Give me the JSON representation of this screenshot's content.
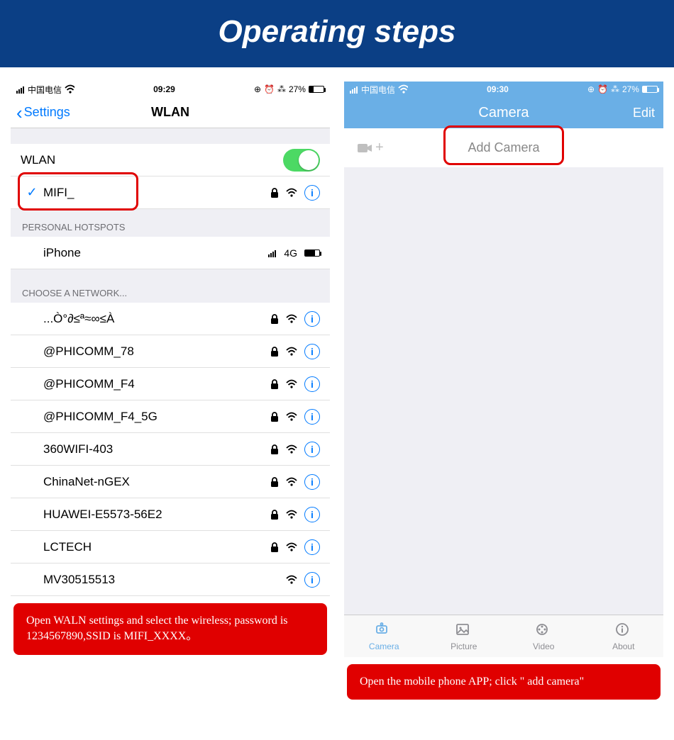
{
  "page_title": "Operating steps",
  "left": {
    "statusbar": {
      "carrier": "中国电信",
      "time": "09:29",
      "battery_pct": "27%"
    },
    "nav": {
      "back": "Settings",
      "title": "WLAN"
    },
    "wlan_toggle_label": "WLAN",
    "connected": {
      "ssid": "MIFI_"
    },
    "section_hotspots": "PERSONAL HOTSPOTS",
    "hotspot": {
      "name": "iPhone",
      "signal": "4G"
    },
    "section_choose": "CHOOSE A NETWORK...",
    "networks": [
      {
        "ssid": "...Ò°∂≤ª≈∞≤À",
        "locked": true
      },
      {
        "ssid": "@PHICOMM_78",
        "locked": true
      },
      {
        "ssid": "@PHICOMM_F4",
        "locked": true
      },
      {
        "ssid": "@PHICOMM_F4_5G",
        "locked": true
      },
      {
        "ssid": "360WIFI-403",
        "locked": true
      },
      {
        "ssid": "ChinaNet-nGEX",
        "locked": true
      },
      {
        "ssid": "HUAWEI-E5573-56E2",
        "locked": true
      },
      {
        "ssid": "LCTECH",
        "locked": true
      },
      {
        "ssid": "MV30515513",
        "locked": false
      }
    ],
    "caption": "Open WALN settings and select the wireless; password is 1234567890,SSID is MIFI_XXXX。"
  },
  "right": {
    "statusbar": {
      "carrier": "中国电信",
      "time": "09:30",
      "battery_pct": "27%"
    },
    "nav": {
      "title": "Camera",
      "right": "Edit"
    },
    "add_label": "Add Camera",
    "tabs": [
      {
        "label": "Camera"
      },
      {
        "label": "Picture"
      },
      {
        "label": "Video"
      },
      {
        "label": "About"
      }
    ],
    "caption": "Open the mobile phone APP; click \" add camera\""
  }
}
